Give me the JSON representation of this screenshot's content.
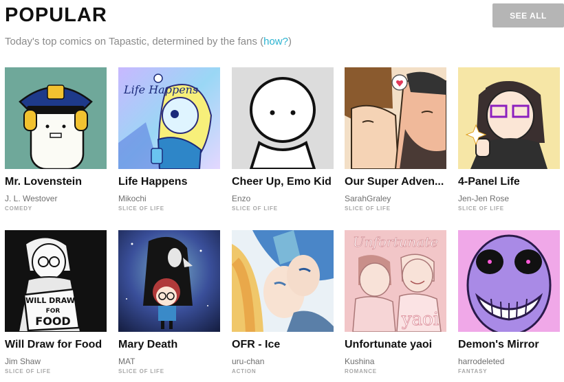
{
  "header": {
    "title": "POPULAR",
    "subtitle_prefix": "Today's top comics on Tapastic, determined by the fans (",
    "subtitle_link": "how?",
    "subtitle_suffix": ")",
    "see_all_label": "SEE ALL"
  },
  "comics": [
    {
      "title": "Mr. Lovenstein",
      "author": "J. L. Westover",
      "genre": "COMEDY",
      "thumb_icon": "police-marshmallow-thumbnail",
      "accent": "#6fa89a"
    },
    {
      "title": "Life Happens",
      "author": "Mikochi",
      "genre": "SLICE OF LIFE",
      "thumb_icon": "blue-haired-girl-thumbnail",
      "accent": "#8a7fe0",
      "thumb_text": "Life Happens"
    },
    {
      "title": "Cheer Up, Emo Kid",
      "author": "Enzo",
      "genre": "SLICE OF LIFE",
      "thumb_icon": "round-face-thumbnail",
      "accent": "#dcdcdc"
    },
    {
      "title": "Our Super Adven...",
      "author": "SarahGraley",
      "genre": "SLICE OF LIFE",
      "thumb_icon": "kissing-couple-thumbnail",
      "accent": "#ef8a9a"
    },
    {
      "title": "4-Panel Life",
      "author": "Jen-Jen Rose",
      "genre": "SLICE OF LIFE",
      "thumb_icon": "thumbs-up-girl-thumbnail",
      "accent": "#f6e6a6"
    },
    {
      "title": "Will Draw for Food",
      "author": "Jim Shaw",
      "genre": "SLICE OF LIFE",
      "thumb_icon": "will-draw-sign-thumbnail",
      "accent": "#111111",
      "thumb_text_lines": [
        "WILL DRAW",
        "FOR",
        "FOOD"
      ]
    },
    {
      "title": "Mary Death",
      "author": "MAT",
      "genre": "SLICE OF LIFE",
      "thumb_icon": "space-reaper-thumbnail",
      "accent": "#3a4f9a"
    },
    {
      "title": "OFR - Ice",
      "author": "uru-chan",
      "genre": "ACTION",
      "thumb_icon": "anime-couple-thumbnail",
      "accent": "#7bb8d8"
    },
    {
      "title": "Unfortunate yaoi",
      "author": "Kushina",
      "genre": "ROMANCE",
      "thumb_icon": "pink-boys-thumbnail",
      "accent": "#f2c6c8",
      "thumb_text": "Unfortunate",
      "thumb_text2": "yaoi"
    },
    {
      "title": "Demon's Mirror",
      "author": "harrodeleted",
      "genre": "FANTASY",
      "thumb_icon": "purple-grin-thumbnail",
      "accent": "#b089e6"
    }
  ]
}
